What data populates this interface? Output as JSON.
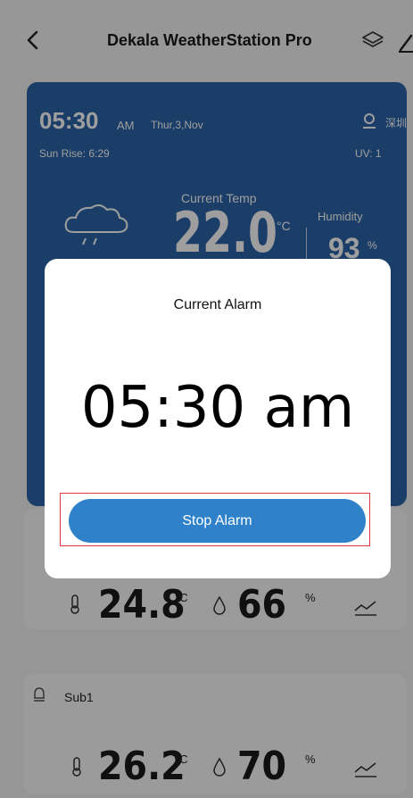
{
  "header": {
    "title": "Dekala WeatherStation Pro",
    "back_icon": "chevron-left-icon",
    "layers_icon": "layers-icon",
    "edit_icon": "edit-icon"
  },
  "main": {
    "time": "05:30",
    "ampm": "AM",
    "date": "Thur,3,Nov",
    "location": "深圳",
    "sunrise": "Sun Rise: 6:29",
    "uv": "UV:   1",
    "current_temp_label": "Current Temp",
    "current_temp": "22.0",
    "temp_unit": "°C",
    "humidity_label": "Humidity",
    "humidity": "93",
    "humidity_unit": "%",
    "weather_icon": "cloud-rain-icon"
  },
  "cards": {
    "indoor": {
      "temp": "24.8",
      "temp_unit": "°C",
      "humidity": "66",
      "humidity_unit": "%"
    },
    "sub1": {
      "name": "Sub1",
      "temp": "26.2",
      "temp_unit": "°C",
      "humidity": "70",
      "humidity_unit": "%"
    }
  },
  "dialog": {
    "title": "Current Alarm",
    "alarm_time": "05:30 am",
    "stop_label": "Stop Alarm"
  },
  "colors": {
    "card_blue": "#2d64aa",
    "button_blue": "#2f82ca",
    "highlight_red": "#e0393e"
  }
}
